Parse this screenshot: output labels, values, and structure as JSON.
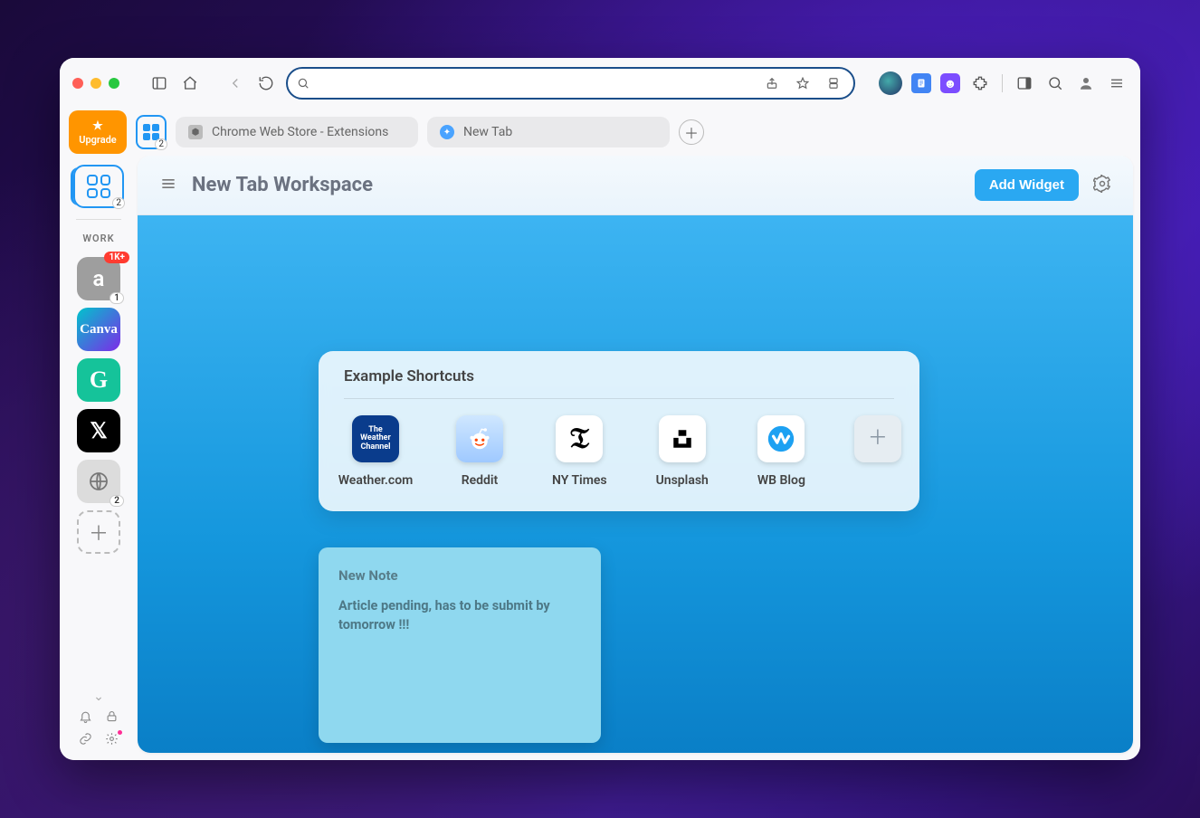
{
  "upgrade_label": "Upgrade",
  "tab_group_count": "2",
  "tabs": [
    {
      "label": "Chrome Web Store - Extensions"
    },
    {
      "label": "New Tab"
    }
  ],
  "sidebar": {
    "active_count": "2",
    "section_label": "WORK",
    "apps": {
      "a": {
        "letter": "a",
        "badge_1k": "1K+",
        "badge_num": "1"
      },
      "canva": {
        "text": "Canva"
      },
      "g": {
        "text": "G"
      },
      "x": {
        "text": "𝕏"
      },
      "globe": {
        "badge_num": "2"
      }
    }
  },
  "workspace": {
    "title": "New Tab Workspace",
    "add_widget_label": "Add Widget"
  },
  "shortcuts": {
    "title": "Example Shortcuts",
    "items": [
      {
        "label": "Weather.com",
        "tile_text": "The Weather Channel"
      },
      {
        "label": "Reddit"
      },
      {
        "label": "NY Times"
      },
      {
        "label": "Unsplash"
      },
      {
        "label": "WB Blog"
      }
    ]
  },
  "note": {
    "title": "New Note",
    "body": "Article pending, has to be submit by tomorrow !!!"
  }
}
